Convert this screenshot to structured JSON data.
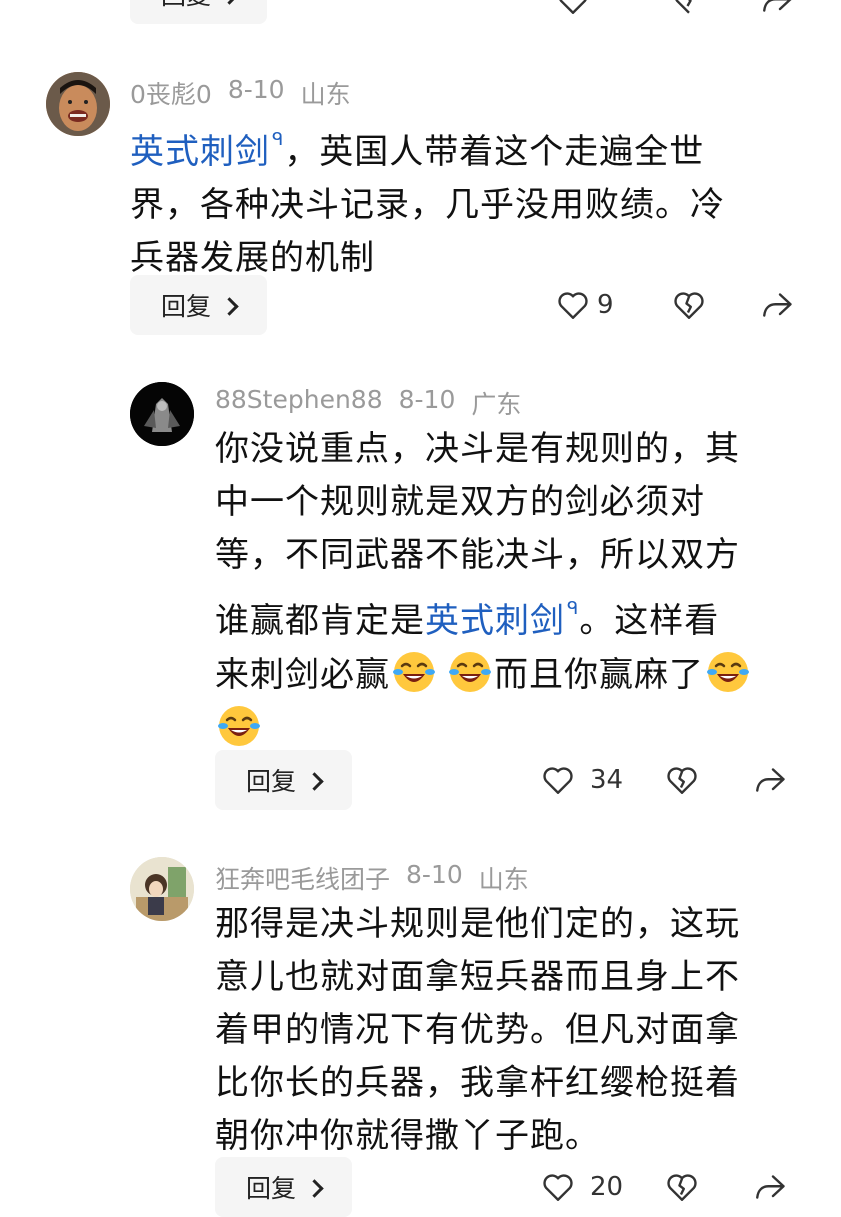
{
  "top_partial": {
    "reply_label": "回复"
  },
  "comments": [
    {
      "user": "0丧彪0",
      "date": "8-10",
      "location": "山东",
      "text_link": "英式刺剑",
      "text_line1_rest": "，英国人带着这个走遍全世",
      "text_line2": "界，各种决斗记录，几乎没用败绩。冷",
      "text_line3": "兵器发展的机制",
      "reply_label": "回复",
      "likes": "9"
    },
    {
      "user": "88Stephen88",
      "date": "8-10",
      "location": "广东",
      "text_line1": "你没说重点，决斗是有规则的，其",
      "text_line2": "中一个规则就是双方的剑必须对",
      "text_line3": "等，不同武器不能决斗，所以双方",
      "text_line4_pre": "谁赢都肯定是",
      "text_link": "英式刺剑",
      "text_line4_post": "。这样看",
      "text_line5_a": "来刺剑必赢",
      "text_line5_b": "而且你赢麻了",
      "reply_label": "回复",
      "likes": "34"
    },
    {
      "user": "狂奔吧毛线团子",
      "date": "8-10",
      "location": "山东",
      "text_line1": "那得是决斗规则是他们定的，这玩",
      "text_line2": "意儿也就对面拿短兵器而且身上不",
      "text_line3": "着甲的情况下有优势。但凡对面拿",
      "text_line4": "比你长的兵器，我拿杆红缨枪挺着",
      "text_line5": "朝你冲你就得撒丫子跑。",
      "reply_label": "回复",
      "likes": "20"
    }
  ],
  "search_glyph": "ᑫ",
  "colors": {
    "link": "#1f5fbf",
    "meta": "#9a9a9a",
    "reply_bg": "#f5f5f5"
  }
}
